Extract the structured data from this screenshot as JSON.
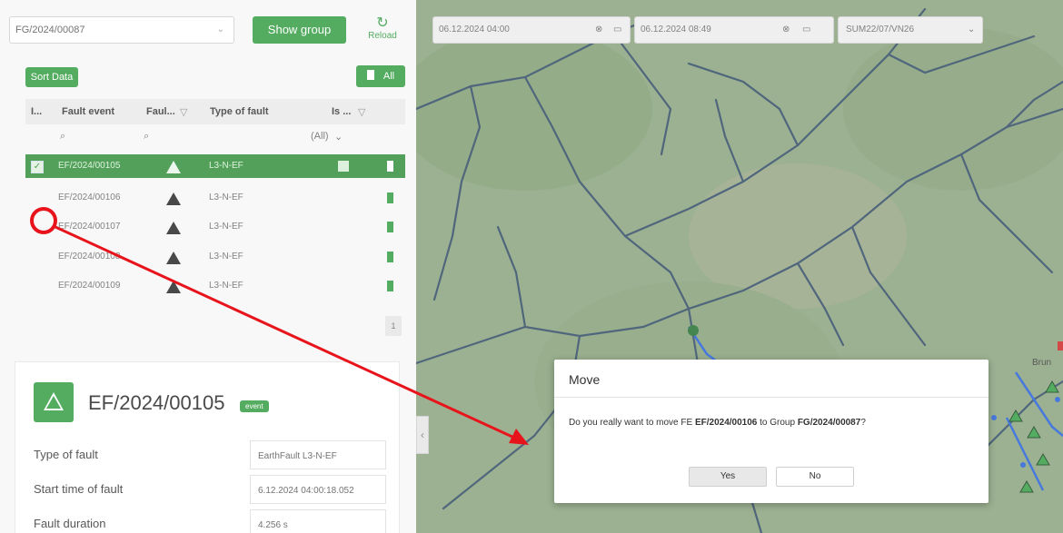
{
  "group_select": {
    "value": "FG/2024/00087"
  },
  "buttons": {
    "show_group": "Show group",
    "reload": "Reload",
    "sort_data": "Sort Data",
    "all": "All"
  },
  "table": {
    "headers": [
      "I...",
      "Fault event",
      "Faul...",
      "Type of fault",
      "Is ..."
    ],
    "filter_all": "(All)",
    "rows": [
      {
        "event": "EF/2024/00105",
        "type": "L3-N-EF",
        "selected": true
      },
      {
        "event": "EF/2024/00106",
        "type": "L3-N-EF",
        "selected": false
      },
      {
        "event": "EF/2024/00107",
        "type": "L3-N-EF",
        "selected": false
      },
      {
        "event": "EF/2024/00108",
        "type": "L3-N-EF",
        "selected": false
      },
      {
        "event": "EF/2024/00109",
        "type": "L3-N-EF",
        "selected": false
      }
    ],
    "pager": "1"
  },
  "detail": {
    "title": "EF/2024/00105",
    "badge": "event",
    "fields": [
      {
        "label": "Type of fault",
        "value": "EarthFault L3-N-EF"
      },
      {
        "label": "Start time of fault",
        "value": "6.12.2024 04:00:18.052"
      },
      {
        "label": "Fault duration",
        "value": "4.256 s"
      }
    ]
  },
  "map_toolbar": {
    "start": "06.12.2024 04:00",
    "end": "06.12.2024 08:49",
    "feeder": "SUM22/07/VN26"
  },
  "map_labels": {
    "place": "Brun"
  },
  "dialog": {
    "title": "Move",
    "msg_pre": "Do you really want to move FE ",
    "msg_event": "EF/2024/00106",
    "msg_mid": " to Group ",
    "msg_group": "FG/2024/00087",
    "msg_post": "?",
    "yes": "Yes",
    "no": "No"
  },
  "colors": {
    "accent": "#2e9a3e",
    "annotation": "#e8141c"
  }
}
